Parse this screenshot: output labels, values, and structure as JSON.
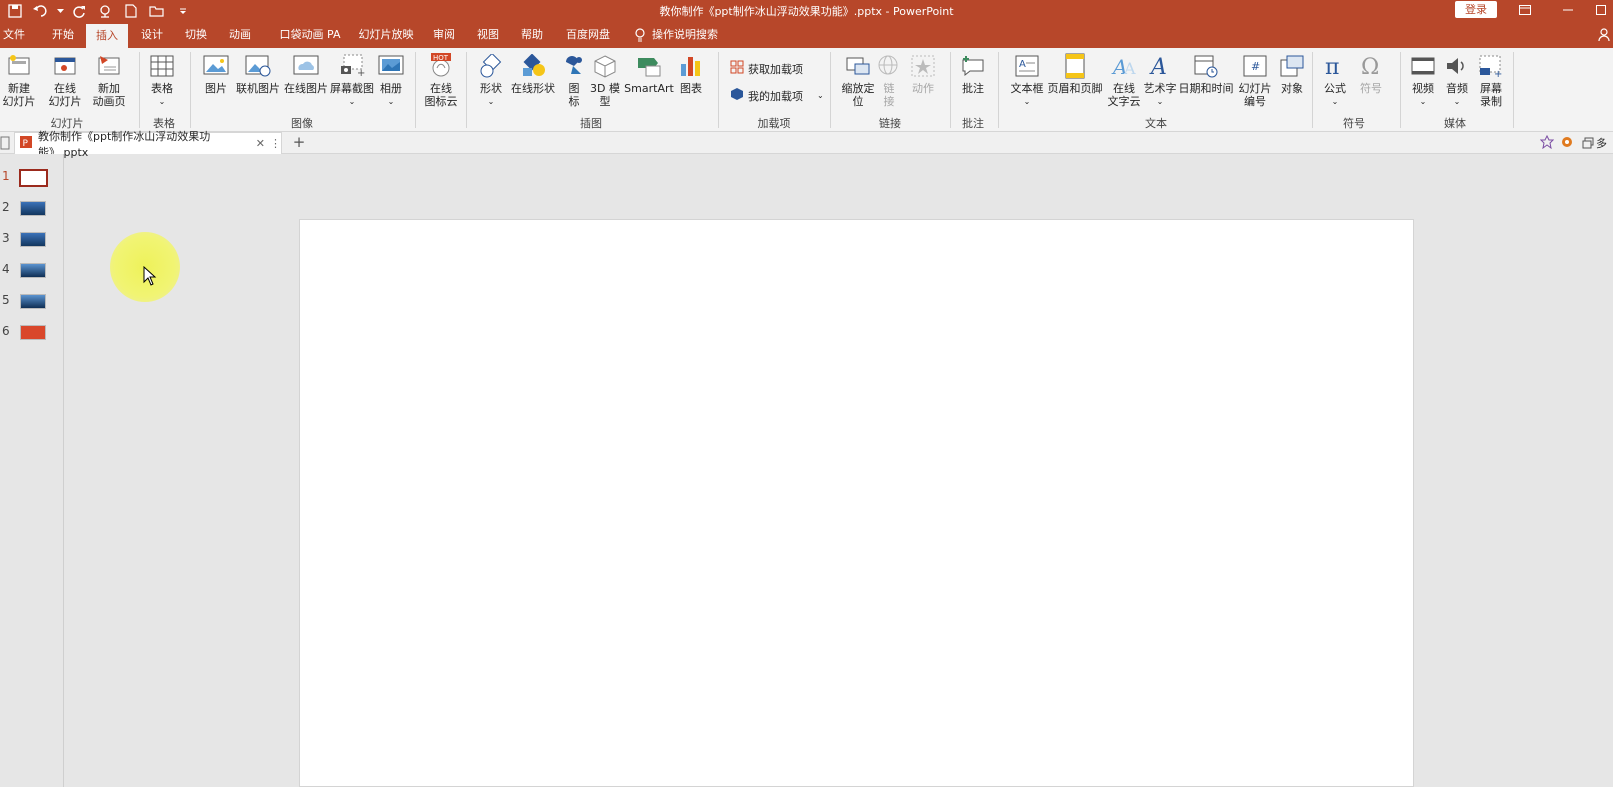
{
  "app": {
    "window_title": "教你制作《ppt制作冰山浮动效果功能》.pptx  -  PowerPoint",
    "login_label": "登录"
  },
  "quick_access": [
    "save-icon",
    "undo-icon",
    "redo-icon",
    "presenter-icon",
    "new-file-icon",
    "open-folder-icon",
    "customize-icon"
  ],
  "tabs": [
    "文件",
    "开始",
    "插入",
    "设计",
    "切换",
    "动画",
    "口袋动画 PA",
    "幻灯片放映",
    "审阅",
    "视图",
    "帮助",
    "百度网盘",
    "操作说明搜索"
  ],
  "active_tab": "插入",
  "ribbon": {
    "slides": {
      "label": "幻灯片",
      "new_slide": "新建\n幻灯片",
      "online_slide": "在线\n幻灯片",
      "new_anim": "新加\n动画页"
    },
    "tables": {
      "label": "表格",
      "table": "表格"
    },
    "images": {
      "label": "图像",
      "picture": "图片",
      "online_picture": "联机图片",
      "online_pic2": "在线图片",
      "screenshot": "屏幕截图",
      "album": "相册"
    },
    "online_icons": {
      "label": "在线\n图标云",
      "hot": "HOT"
    },
    "illustrations": {
      "label": "插图",
      "shapes": "形状",
      "online_shapes": "在线形状",
      "icons": "图\n标",
      "model3d": "3D 模\n型",
      "smartart": "SmartArt",
      "chart": "图表"
    },
    "addins": {
      "label": "加载项",
      "get": "获取加载项",
      "my": "我的加载项"
    },
    "links": {
      "label": "链接",
      "zoom": "缩放定\n位",
      "link": "链\n接",
      "action": "动作"
    },
    "comments": {
      "label": "批注",
      "comment": "批注"
    },
    "text": {
      "label": "文本",
      "textbox": "文本框",
      "header_footer": "页眉和页脚",
      "online_wordcloud": "在线\n文字云",
      "wordart": "艺术字",
      "datetime": "日期和时间",
      "slide_number": "幻灯片\n编号",
      "object": "对象"
    },
    "symbols": {
      "label": "符号",
      "equation": "公式",
      "symbol": "符号"
    },
    "media": {
      "label": "媒体",
      "video": "视频",
      "audio": "音频",
      "screen_record": "屏幕\n录制"
    }
  },
  "document_tab": {
    "name": "教你制作《ppt制作冰山浮动效果功能》.pptx",
    "right_label": "多"
  },
  "slides": [
    {
      "num": "1",
      "color": "#ffffff",
      "active": true
    },
    {
      "num": "2",
      "color": "#1e5aa0",
      "active": false
    },
    {
      "num": "3",
      "color": "#1e5aa0",
      "active": false
    },
    {
      "num": "4",
      "color": "#1a4f8a",
      "active": false
    },
    {
      "num": "5",
      "color": "#1a4f8a",
      "active": false
    },
    {
      "num": "6",
      "color": "#d9472b",
      "active": false
    }
  ],
  "colors": {
    "accent": "#b7472a",
    "ribbon_bg": "#f3f3f3",
    "workspace_bg": "#e6e6e6"
  }
}
